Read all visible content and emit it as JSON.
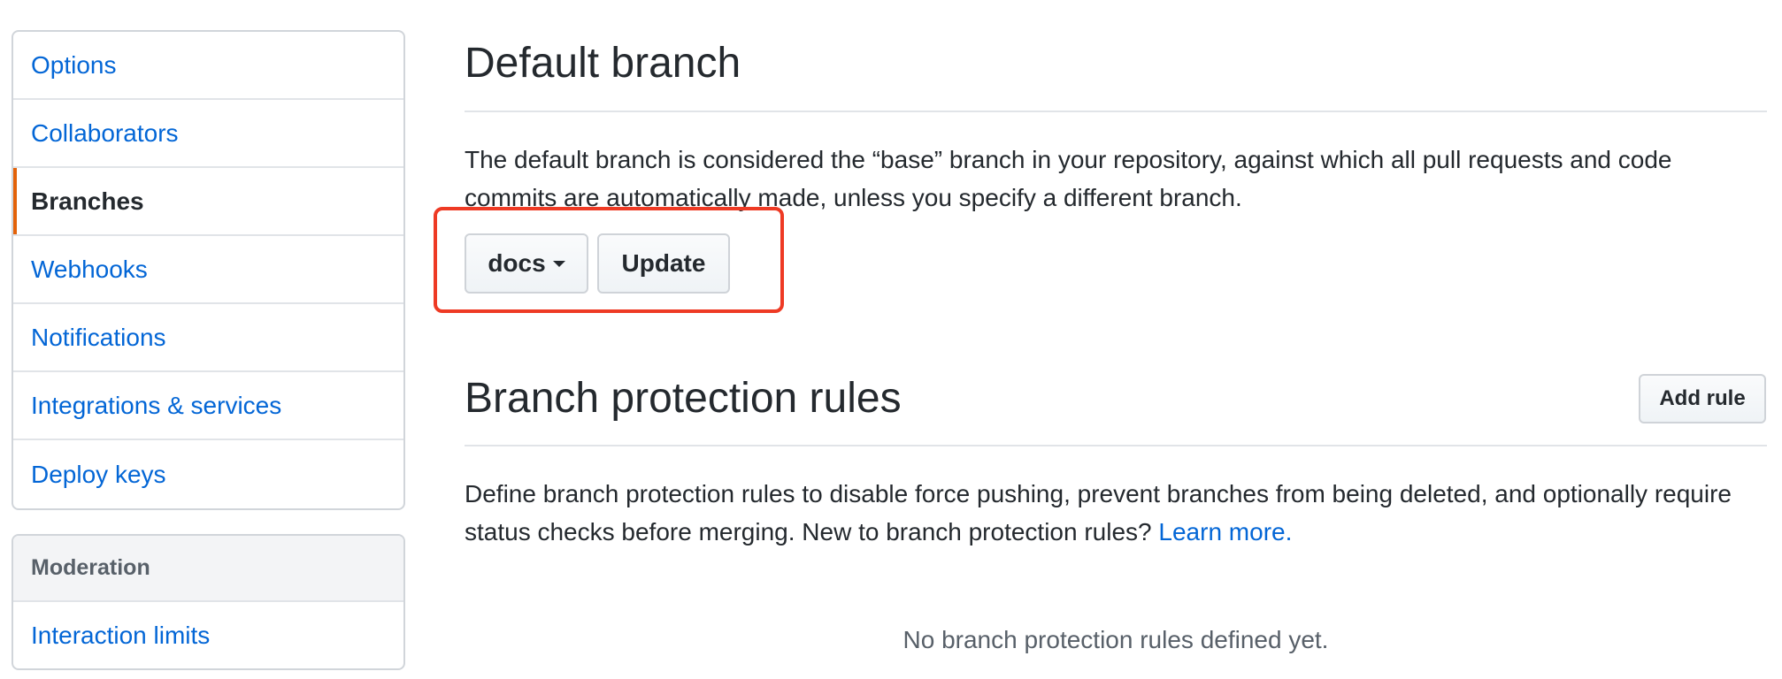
{
  "sidebar": {
    "items": [
      {
        "label": "Options"
      },
      {
        "label": "Collaborators"
      },
      {
        "label": "Branches"
      },
      {
        "label": "Webhooks"
      },
      {
        "label": "Notifications"
      },
      {
        "label": "Integrations & services"
      },
      {
        "label": "Deploy keys"
      }
    ],
    "selected": "Branches",
    "moderation": {
      "heading": "Moderation",
      "items": [
        {
          "label": "Interaction limits"
        }
      ]
    }
  },
  "default_branch": {
    "title": "Default branch",
    "description": "The default branch is considered the “base” branch in your repository, against which all pull requests and code commits are automatically made, unless you specify a different branch.",
    "selected_branch": "docs",
    "update_label": "Update"
  },
  "protection": {
    "title": "Branch protection rules",
    "add_rule_label": "Add rule",
    "description": "Define branch protection rules to disable force pushing, prevent branches from being deleted, and optionally require status checks before merging. New to branch protection rules?",
    "learn_more": "Learn more.",
    "empty_state": "No branch protection rules defined yet."
  },
  "colors": {
    "link": "#0366d6",
    "selected_accent": "#e36209",
    "highlight": "#ee3a24"
  }
}
